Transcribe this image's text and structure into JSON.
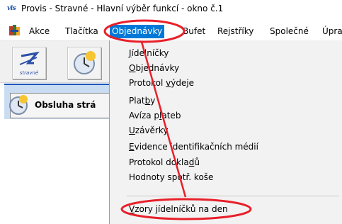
{
  "window": {
    "icon_text": "vis",
    "title": "Provis - Stravné - Hlavní výběr funkcí - okno č.1"
  },
  "menubar": {
    "items": [
      {
        "label": "Akce"
      },
      {
        "label": "Tlačítka"
      },
      {
        "label": "Objednávky"
      },
      {
        "label": "Bufet"
      },
      {
        "label": "Rejstříky"
      },
      {
        "label": "Společné"
      },
      {
        "label": "Úpra"
      }
    ],
    "active_color": "#0078d7"
  },
  "toolbar": {
    "buttons": [
      {
        "icon": "stravne-icon",
        "caption": "stravné"
      },
      {
        "icon": "clock-icon"
      }
    ]
  },
  "panel": {
    "label": "Obsluha strá"
  },
  "dropdown": {
    "items": [
      {
        "pre": "",
        "ul": "J",
        "post": "ídelníčky"
      },
      {
        "pre": "",
        "ul": "O",
        "post": "bjednávky"
      },
      {
        "pre": "Protokol ",
        "ul": "v",
        "post": "ýdeje"
      },
      {
        "pre": "Plat",
        "ul": "b",
        "post": "y"
      },
      {
        "pre": "Avíza p",
        "ul": "l",
        "post": "ateb"
      },
      {
        "pre": "",
        "ul": "U",
        "post": "závěrky"
      },
      {
        "pre": "",
        "ul": "E",
        "post": "vidence identifikačních médií"
      },
      {
        "pre": "Protokol dokla",
        "ul": "d",
        "post": "ů"
      },
      {
        "pre": "Hodnoty spotř. koše",
        "ul": "",
        "post": ""
      },
      {
        "pre": "",
        "ul": "V",
        "post": "zory jídelníčků na den"
      }
    ]
  },
  "annotation": {
    "color": "#e8202a"
  }
}
